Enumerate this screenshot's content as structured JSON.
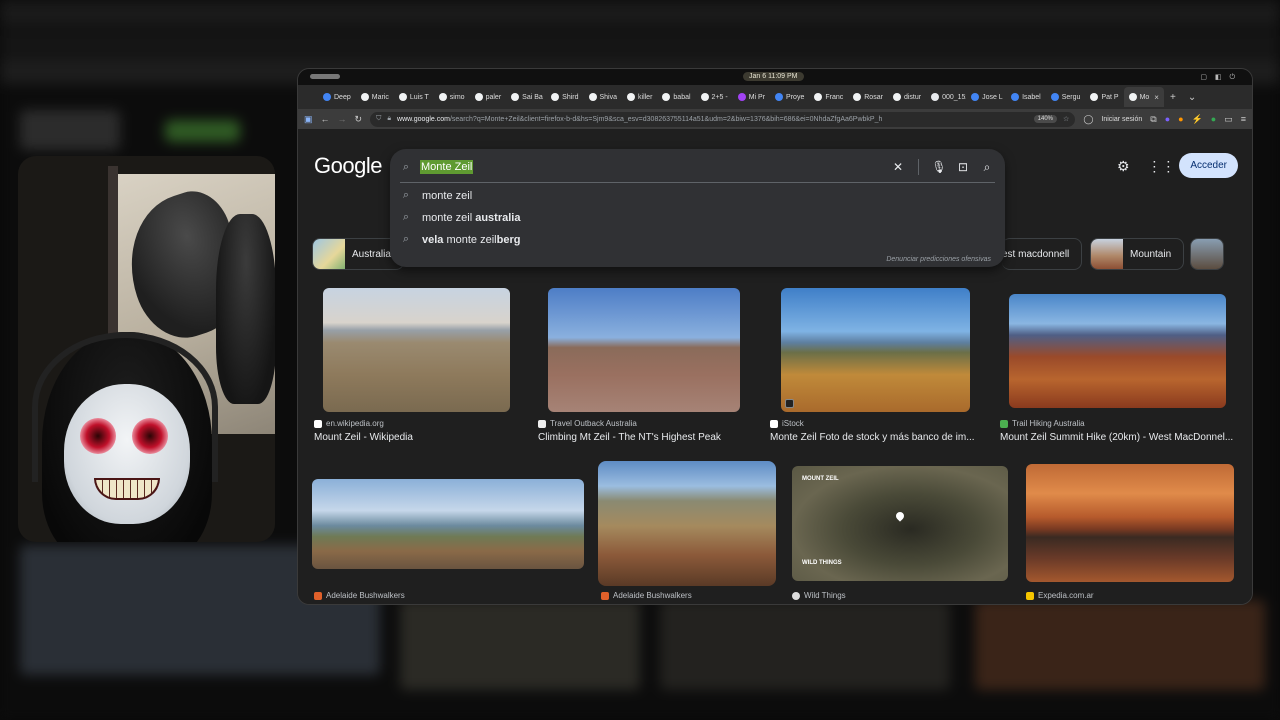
{
  "clock": "Jan 6  11:09 PM",
  "tabs": [
    {
      "label": "Deep",
      "color": "#4285f4"
    },
    {
      "label": "Maric",
      "color": "#f1f3f4"
    },
    {
      "label": "Luis T",
      "color": "#f1f3f4"
    },
    {
      "label": "simo",
      "color": "#f1f3f4"
    },
    {
      "label": "paler",
      "color": "#f1f3f4"
    },
    {
      "label": "Sai Ba",
      "color": "#f1f3f4"
    },
    {
      "label": "Shird",
      "color": "#f1f3f4"
    },
    {
      "label": "Shiva",
      "color": "#f1f3f4"
    },
    {
      "label": "killer",
      "color": "#f1f3f4"
    },
    {
      "label": "babal",
      "color": "#f1f3f4"
    },
    {
      "label": "2+5 -",
      "color": "#f1f3f4"
    },
    {
      "label": "Mi Pr",
      "color": "#a142f4"
    },
    {
      "label": "Proye",
      "color": "#4285f4"
    },
    {
      "label": "Franc",
      "color": "#f1f3f4"
    },
    {
      "label": "Rosar",
      "color": "#f1f3f4"
    },
    {
      "label": "distur",
      "color": "#f1f3f4"
    },
    {
      "label": "000_152",
      "color": "#e8eaed"
    },
    {
      "label": "Jose L",
      "color": "#4285f4"
    },
    {
      "label": "Isabel",
      "color": "#4285f4"
    },
    {
      "label": "Sergu",
      "color": "#4285f4"
    },
    {
      "label": "Pat P",
      "color": "#f1f3f4"
    }
  ],
  "active_tab": {
    "label": "Mo",
    "close": "×"
  },
  "tab_add": "+",
  "tab_list": "⌄",
  "nav": {
    "url_domain": "www.google.com",
    "url_rest": "/search?q=Monte+Zeil&client=firefox-b-d&hs=Sjm9&sca_esv=d308263755114a51&udm=2&biw=1376&bih=686&ei=0NhdaZfgAa6PwbkP_h",
    "zoom": "140%",
    "login": "Iniciar sesión"
  },
  "google": {
    "logo": "Google",
    "signin": "Acceder"
  },
  "search": {
    "query": "Monte Zeil",
    "suggestions": [
      {
        "pre": "",
        "plain": "monte zeil",
        "bold": ""
      },
      {
        "pre": "",
        "plain": "monte zeil ",
        "bold": "australia"
      },
      {
        "pre": "vela",
        "plain": " monte zeil",
        "bold": "berg"
      }
    ],
    "report": "Denunciar predicciones ofensivas"
  },
  "chips": [
    {
      "label": "Australia",
      "color": "#8fb7d6"
    },
    {
      "label": "est macdonnell",
      "color": "#b4694a"
    },
    {
      "label": "Mountain",
      "color": "#a86d4e"
    }
  ],
  "results": [
    {
      "source": "en.wikipedia.org",
      "title": "Mount Zeil - Wikipedia",
      "fav": "#ffffff"
    },
    {
      "source": "Travel Outback Australia",
      "title": "Climbing Mt Zeil - The NT's Highest Peak",
      "fav": "#eeeeee"
    },
    {
      "source": "iStock",
      "title": "Monte Zeil Foto de stock y más banco de im...",
      "fav": "#ffffff"
    },
    {
      "source": "Trail Hiking Australia",
      "title": "Mount Zeil Summit Hike (20km) - West MacDonnel...",
      "fav": "#4caf50"
    },
    {
      "source": "Adelaide Bushwalkers",
      "title": "",
      "fav": "#e0602a"
    },
    {
      "source": "Adelaide Bushwalkers",
      "title": "",
      "fav": "#e0602a"
    },
    {
      "source": "Wild Things",
      "title": "",
      "fav": "#dddddd"
    },
    {
      "source": "Expedia.com.ar",
      "title": "",
      "fav": "#f7c600"
    }
  ],
  "map_labels": {
    "title": "MOUNT ZEIL",
    "brand": "WILD THINGS"
  }
}
